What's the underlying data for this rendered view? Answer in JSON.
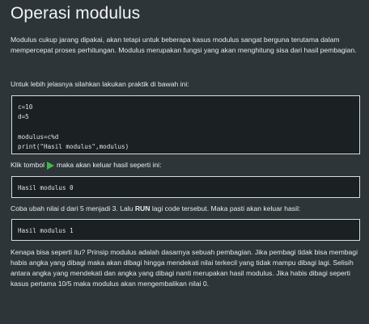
{
  "page": {
    "title": "Operasi modulus",
    "intro": "Modulus cukup jarang dipakai, akan tetapi untuk beberapa kasus modulus sangat berguna terutama dalam mempercepat proses perhitungan. Modulus merupakan fungsi yang akan menghitung sisa dari hasil pembagian.",
    "lead": "Untuk lebih jelasnya silahkan lakukan praktik di bawah ini:",
    "code": "c=10\nd=5\n\nmodulus=c%d\nprint(\"Hasil modulus\",modulus)",
    "click_before": "Klik tombol",
    "click_after": "maka akan keluar hasil seperti ini:",
    "output_1": "Hasil modulus 0",
    "change_before": "Coba ubah nilai d dari 5 menjadi 3. Lalu ",
    "change_run": "RUN",
    "change_after": " lagi code tersebut. Maka pasti akan keluar hasil:",
    "output_2": "Hasil modulus 1",
    "closing": "Kenapa bisa seperti itu? Prinsip modulus adalah dasarnya sebuah pembagian. Jika pembagi tidak bisa membagi habis angka yang dibagi maka akan dibagi hingga mendekati nilai terkecil yang tidak mampu dibagi lagi. Selisih antara angka yang mendekati dan angka yang dibagi nanti merupakan hasil modulus. Jika habis dibagi seperti kasus pertama 10/5 maka modulus akan mengembalikan nilai 0."
  },
  "icons": {
    "run": "play-icon"
  },
  "colors": {
    "background": "#2e3538",
    "code_background": "#1b2122",
    "code_border": "#d7dbdd",
    "play": "#3dba4e"
  }
}
